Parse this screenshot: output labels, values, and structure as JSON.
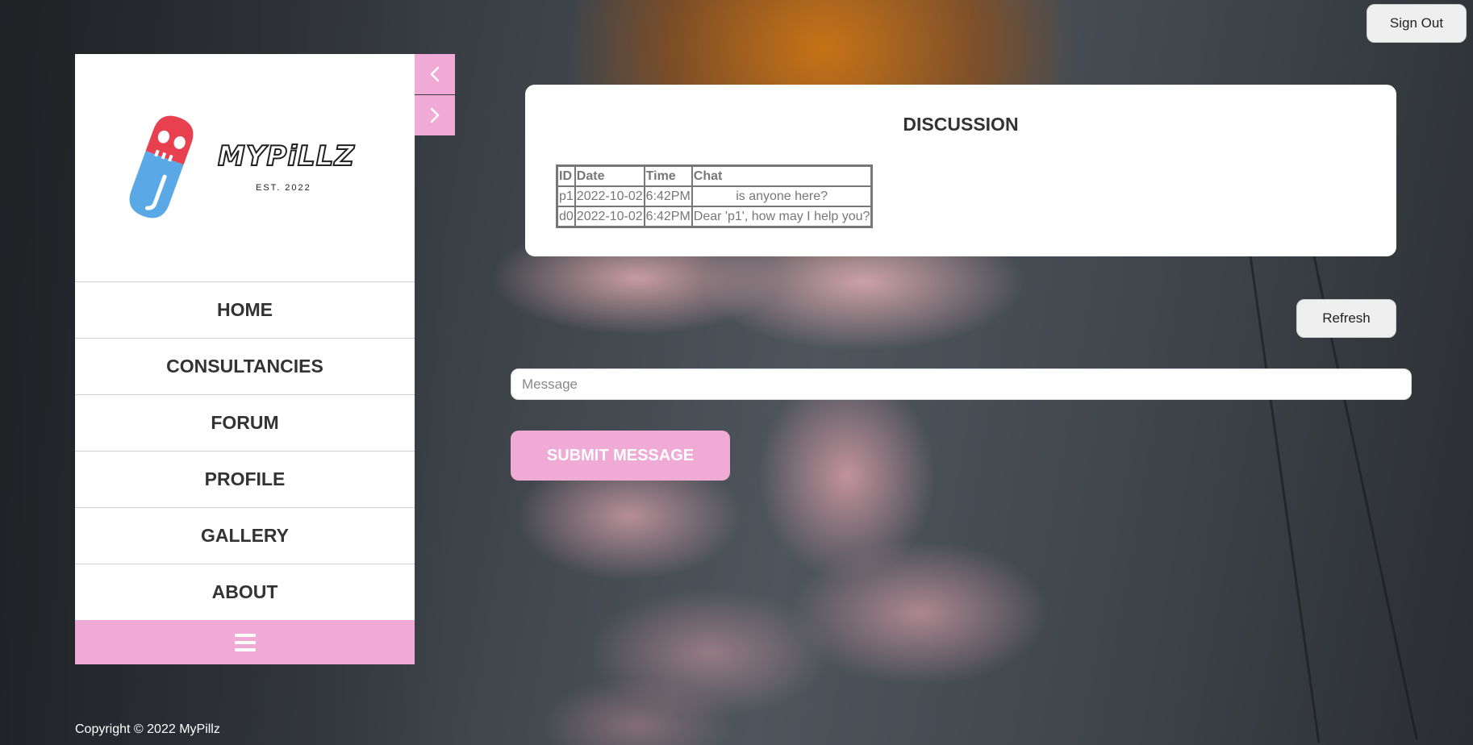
{
  "header": {
    "sign_out_label": "Sign Out"
  },
  "sidebar": {
    "logo": {
      "wordmark": "MYPiLLZ",
      "tagline": "EST. 2022"
    },
    "nav_items": [
      {
        "label": "HOME"
      },
      {
        "label": "CONSULTANCIES"
      },
      {
        "label": "FORUM"
      },
      {
        "label": "PROFILE"
      },
      {
        "label": "GALLERY"
      },
      {
        "label": "ABOUT"
      }
    ]
  },
  "discussion": {
    "title": "DISCUSSION",
    "columns": [
      "ID",
      "Date",
      "Time",
      "Chat"
    ],
    "rows": [
      {
        "id": "p1",
        "date": "2022-10-02",
        "time": "6:42PM",
        "chat": "is anyone here?"
      },
      {
        "id": "d0",
        "date": "2022-10-02",
        "time": "6:42PM",
        "chat": "Dear 'p1', how may I help you?"
      }
    ]
  },
  "actions": {
    "refresh_label": "Refresh",
    "message_placeholder": "Message",
    "submit_label": "SUBMIT MESSAGE"
  },
  "footer": {
    "copyright": "Copyright © 2022 MyPillz"
  },
  "icons": {
    "prev": "chevron-left-icon",
    "next": "chevron-right-icon",
    "menu": "hamburger-icon"
  },
  "colors": {
    "accent_pink": "#f0aad6",
    "logo_red": "#e8404e",
    "logo_blue": "#5aa9e6"
  }
}
